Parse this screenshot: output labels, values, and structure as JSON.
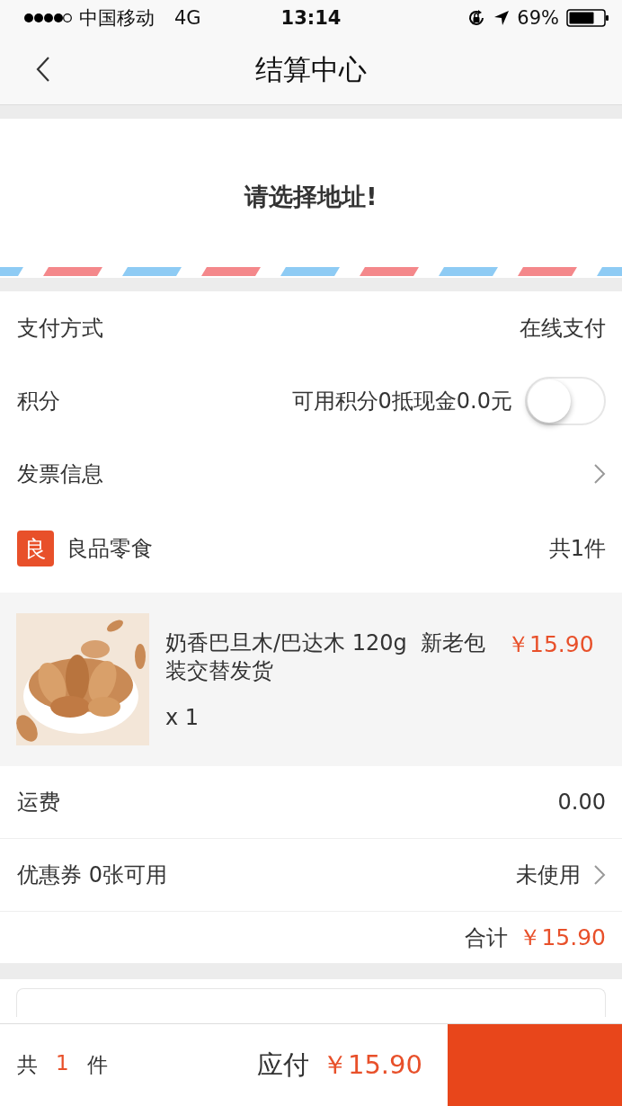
{
  "status_bar": {
    "carrier": "中国移动",
    "network": "4G",
    "time": "13:14",
    "battery": "69%"
  },
  "nav": {
    "title": "结算中心"
  },
  "address": {
    "prompt": "请选择地址!"
  },
  "settings": [
    {
      "kind": "value",
      "label": "支付方式",
      "value": "在线支付"
    },
    {
      "kind": "toggle",
      "label": "积分",
      "value": "可用积分0抵现金0.0元",
      "on": false
    },
    {
      "kind": "link",
      "label": "发票信息"
    }
  ],
  "shop": {
    "badge": "良",
    "name": "良品零食",
    "count": "共1件"
  },
  "products": [
    {
      "title": "奶香巴旦木/巴达木 120g  新老包装交替发货",
      "price": "￥15.90",
      "quantity": "x 1"
    }
  ],
  "fees": [
    {
      "kind": "value",
      "label": "运费",
      "value": "0.00"
    },
    {
      "kind": "link",
      "label": "优惠券 0张可用",
      "value": "未使用"
    }
  ],
  "total": {
    "label": "合计",
    "amount": "￥15.90"
  },
  "bottom_bar": {
    "count_prefix": "共",
    "count": "1",
    "count_suffix": "件",
    "due_label": "应付",
    "due_amount": "￥15.90"
  }
}
